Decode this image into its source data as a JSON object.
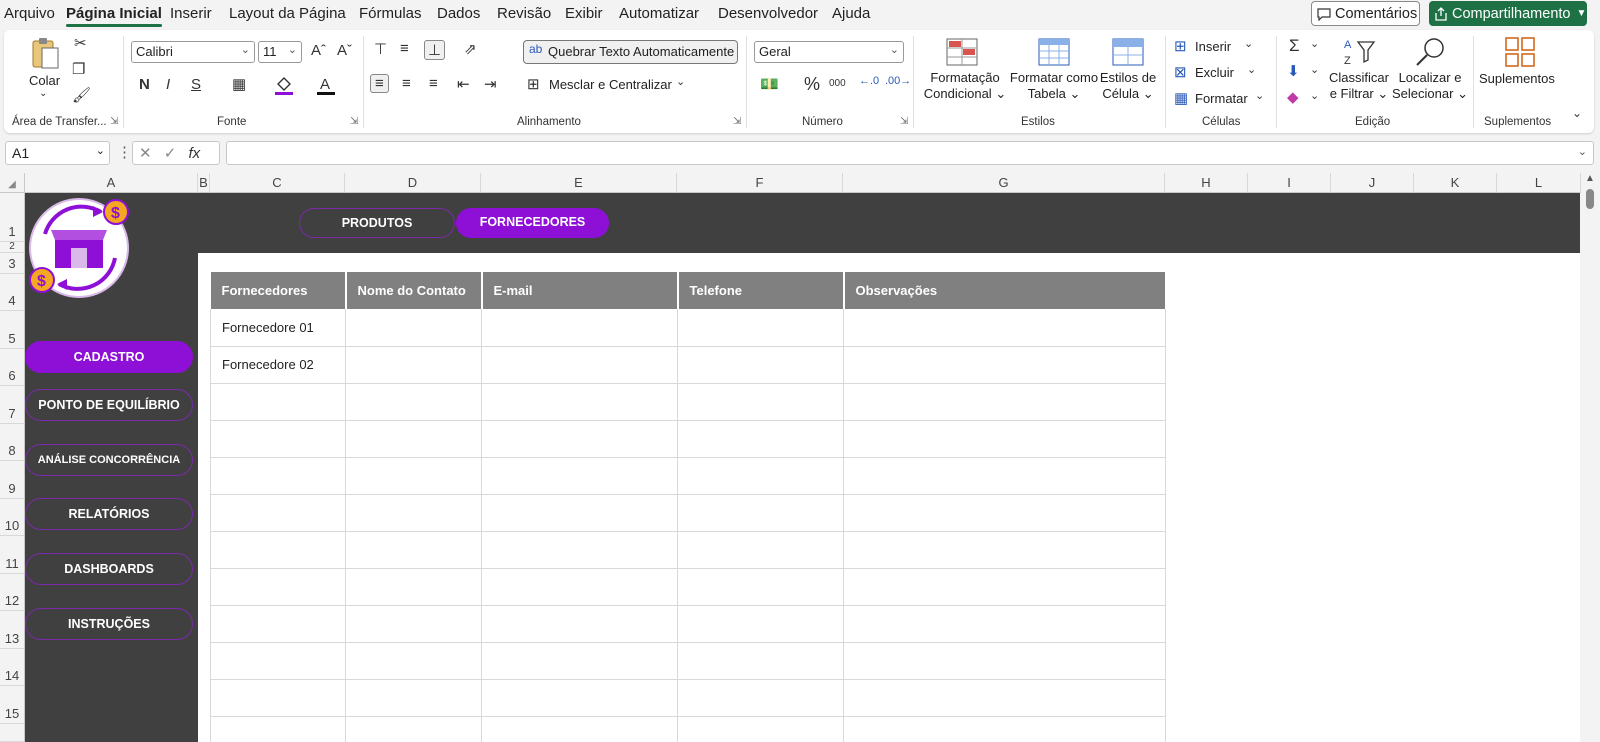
{
  "menu": {
    "items": [
      "Arquivo",
      "Página Inicial",
      "Inserir",
      "Layout da Página",
      "Fórmulas",
      "Dados",
      "Revisão",
      "Exibir",
      "Automatizar",
      "Desenvolvedor",
      "Ajuda"
    ],
    "comments": "Comentários",
    "share": "Compartilhamento"
  },
  "ribbon": {
    "clipboard": {
      "paste": "Colar",
      "label": "Área de Transfer..."
    },
    "font": {
      "name": "Calibri",
      "size": "11",
      "bold": "N",
      "italic": "I",
      "underline": "S",
      "label": "Fonte"
    },
    "alignment": {
      "wrap": "Quebrar Texto Automaticamente",
      "merge": "Mesclar e Centralizar",
      "label": "Alinhamento"
    },
    "number": {
      "format": "Geral",
      "label": "Número"
    },
    "styles": {
      "conditional": [
        "Formatação",
        "Condicional"
      ],
      "as_table": [
        "Formatar como",
        "Tabela"
      ],
      "cell_styles": [
        "Estilos de",
        "Célula"
      ],
      "label": "Estilos"
    },
    "cells": {
      "insert": "Inserir",
      "delete": "Excluir",
      "format": "Formatar",
      "label": "Células"
    },
    "editing": {
      "sort": [
        "Classificar",
        "e Filtrar"
      ],
      "find": [
        "Localizar e",
        "Selecionar"
      ],
      "label": "Edição"
    },
    "addins": {
      "button": "Suplementos",
      "label": "Suplementos"
    }
  },
  "formula_bar": {
    "name_box": "A1",
    "fx": "fx",
    "value": ""
  },
  "columns": [
    "A",
    "B",
    "C",
    "D",
    "E",
    "F",
    "G",
    "H",
    "I",
    "J",
    "K",
    "L"
  ],
  "rows": [
    "1",
    "2",
    "3",
    "4",
    "5",
    "6",
    "7",
    "8",
    "9",
    "10",
    "11",
    "12",
    "13",
    "14",
    "15"
  ],
  "sheet": {
    "top_tabs": [
      "PRODUTOS",
      "FORNECEDORES"
    ],
    "active_tab": "FORNECEDORES",
    "nav": [
      "CADASTRO",
      "PONTO DE EQUILÍBRIO",
      "ANÁLISE CONCORRÊNCIA",
      "RELATÓRIOS",
      "DASHBOARDS",
      "INSTRUÇÕES"
    ],
    "active_nav": "CADASTRO",
    "table": {
      "headers": [
        "Fornecedores",
        "Nome do Contato",
        "E-mail",
        "Telefone",
        "Observações"
      ],
      "rows": [
        [
          "Fornecedore 01",
          "",
          "",
          "",
          ""
        ],
        [
          "Fornecedore 02",
          "",
          "",
          "",
          ""
        ],
        [
          "",
          "",
          "",
          "",
          ""
        ],
        [
          "",
          "",
          "",
          "",
          ""
        ],
        [
          "",
          "",
          "",
          "",
          ""
        ],
        [
          "",
          "",
          "",
          "",
          ""
        ],
        [
          "",
          "",
          "",
          "",
          ""
        ],
        [
          "",
          "",
          "",
          "",
          ""
        ],
        [
          "",
          "",
          "",
          "",
          ""
        ],
        [
          "",
          "",
          "",
          "",
          ""
        ],
        [
          "",
          "",
          "",
          "",
          ""
        ],
        [
          "",
          "",
          "",
          "",
          ""
        ]
      ]
    }
  },
  "colors": {
    "accent": "#8e0fd6",
    "dark_band": "#404040",
    "header_gray": "#808080",
    "excel_green": "#1e7145"
  },
  "icons": [
    "paste-icon",
    "cut-icon",
    "copy-icon",
    "format-painter-icon",
    "logo-store-icon",
    "sum-icon",
    "sort-filter-icon",
    "find-icon",
    "addins-icon"
  ]
}
